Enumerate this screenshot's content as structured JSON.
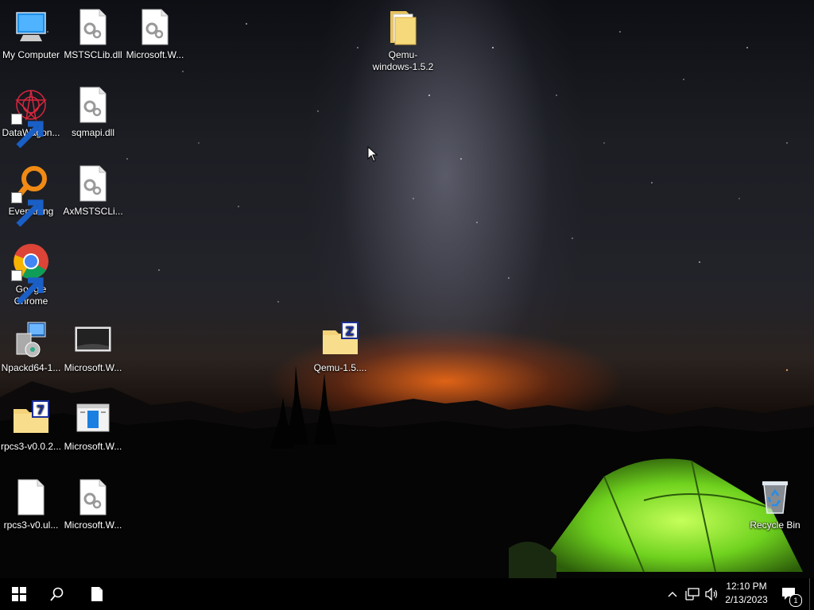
{
  "desktop": {
    "icons": [
      {
        "id": "my-computer",
        "label": "My Computer"
      },
      {
        "id": "mstsclib",
        "label": "MSTSCLib.dll"
      },
      {
        "id": "microsoft-w-1",
        "label": "Microsoft.W..."
      },
      {
        "id": "qemu-windows-folder",
        "label": "Qemu-windows-1.5.2"
      },
      {
        "id": "datawagon",
        "label": "DataWagon..."
      },
      {
        "id": "sqmapi",
        "label": "sqmapi.dll"
      },
      {
        "id": "everything",
        "label": "Everything"
      },
      {
        "id": "axmstsclib",
        "label": "AxMSTSCLi..."
      },
      {
        "id": "google-chrome",
        "label": "Google Chrome"
      },
      {
        "id": "npackd",
        "label": "Npackd64-1..."
      },
      {
        "id": "microsoft-w-2",
        "label": "Microsoft.W..."
      },
      {
        "id": "qemu-zip",
        "label": "Qemu-1.5...."
      },
      {
        "id": "rpcs3-7z",
        "label": "rpcs3-v0.0.2..."
      },
      {
        "id": "microsoft-w-3",
        "label": "Microsoft.W..."
      },
      {
        "id": "rpcs3-ul",
        "label": "rpcs3-v0.ul..."
      },
      {
        "id": "microsoft-w-4",
        "label": "Microsoft.W..."
      },
      {
        "id": "recycle-bin",
        "label": "Recycle Bin"
      }
    ]
  },
  "taskbar": {
    "clock_time": "12:10 PM",
    "clock_date": "2/13/2023",
    "notification_count": "1"
  }
}
